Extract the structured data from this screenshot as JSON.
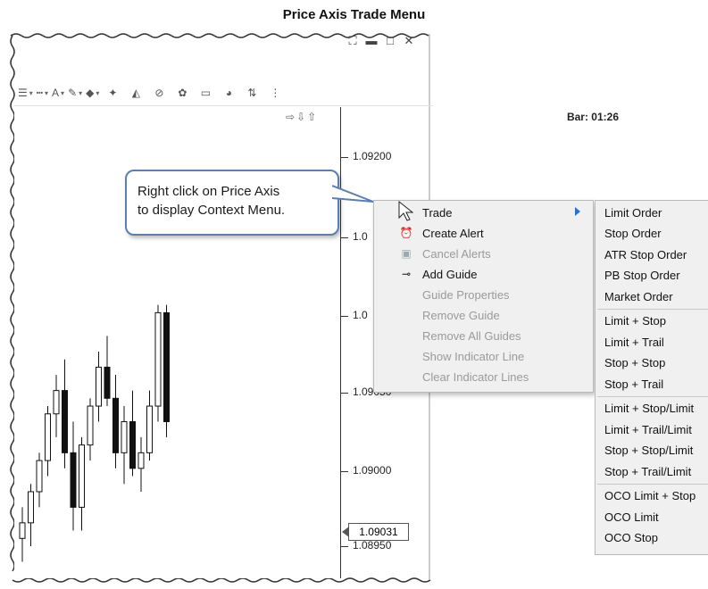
{
  "title": "Price Axis Trade Menu",
  "window_controls": {
    "maximize": "⛶",
    "minimize": "▬",
    "restore": "□",
    "close": "✕"
  },
  "toolbar": {
    "items": [
      {
        "icon": "lines-icon",
        "glyph": "☰",
        "dropdown": true
      },
      {
        "icon": "line-style-icon",
        "glyph": "┅",
        "dropdown": true
      },
      {
        "icon": "text-color-icon",
        "glyph": "A",
        "dropdown": true
      },
      {
        "icon": "pen-color-icon",
        "glyph": "✎",
        "dropdown": true
      },
      {
        "icon": "fill-color-icon",
        "glyph": "◆",
        "dropdown": true
      },
      {
        "icon": "chart-tool-icon",
        "glyph": "✦",
        "dropdown": false
      },
      {
        "icon": "callout-tool-icon",
        "glyph": "◭",
        "dropdown": false
      },
      {
        "icon": "hide-drawings-icon",
        "glyph": "⊘",
        "dropdown": false
      },
      {
        "icon": "indicator-icon",
        "glyph": "✿",
        "dropdown": false
      },
      {
        "icon": "panel-icon",
        "glyph": "▭",
        "dropdown": false
      },
      {
        "icon": "overlay-icon",
        "glyph": "◕",
        "dropdown": false
      },
      {
        "icon": "trade-arrows-icon",
        "glyph": "⇅",
        "dropdown": false
      },
      {
        "icon": "more-icon",
        "glyph": "⋮",
        "dropdown": false
      }
    ]
  },
  "chart": {
    "bar_info": "Bar: 01:26",
    "bar_arrows": "⇨⇩⇧",
    "price_labels": [
      "1.09200",
      "1.0",
      "1.0",
      "1.09050",
      "1.09000",
      "1.08950"
    ],
    "current_price": "1.09031",
    "candles": [
      {
        "o": 1.08955,
        "h": 1.08975,
        "l": 1.0894,
        "c": 1.08965,
        "bull": true
      },
      {
        "o": 1.08965,
        "h": 1.0899,
        "l": 1.0895,
        "c": 1.08985,
        "bull": true
      },
      {
        "o": 1.08985,
        "h": 1.0901,
        "l": 1.08975,
        "c": 1.09005,
        "bull": true
      },
      {
        "o": 1.09005,
        "h": 1.0904,
        "l": 1.08995,
        "c": 1.09035,
        "bull": true
      },
      {
        "o": 1.09035,
        "h": 1.0906,
        "l": 1.0902,
        "c": 1.0905,
        "bull": true
      },
      {
        "o": 1.0905,
        "h": 1.0907,
        "l": 1.09,
        "c": 1.0901,
        "bull": false
      },
      {
        "o": 1.0901,
        "h": 1.0903,
        "l": 1.0896,
        "c": 1.08975,
        "bull": false
      },
      {
        "o": 1.08975,
        "h": 1.0902,
        "l": 1.0896,
        "c": 1.09015,
        "bull": true
      },
      {
        "o": 1.09015,
        "h": 1.09045,
        "l": 1.09005,
        "c": 1.0904,
        "bull": true
      },
      {
        "o": 1.0904,
        "h": 1.09075,
        "l": 1.0903,
        "c": 1.09065,
        "bull": true
      },
      {
        "o": 1.09065,
        "h": 1.09085,
        "l": 1.0904,
        "c": 1.09045,
        "bull": false
      },
      {
        "o": 1.09045,
        "h": 1.0906,
        "l": 1.09,
        "c": 1.0901,
        "bull": false
      },
      {
        "o": 1.0901,
        "h": 1.0904,
        "l": 1.0899,
        "c": 1.0903,
        "bull": true
      },
      {
        "o": 1.0903,
        "h": 1.0905,
        "l": 1.08995,
        "c": 1.09,
        "bull": false
      },
      {
        "o": 1.09,
        "h": 1.0902,
        "l": 1.08985,
        "c": 1.0901,
        "bull": true
      },
      {
        "o": 1.0901,
        "h": 1.0905,
        "l": 1.09005,
        "c": 1.0904,
        "bull": true
      },
      {
        "o": 1.0904,
        "h": 1.09105,
        "l": 1.0903,
        "c": 1.091,
        "bull": true
      },
      {
        "o": 1.091,
        "h": 1.09105,
        "l": 1.0902,
        "c": 1.0903,
        "bull": false
      }
    ]
  },
  "callout": {
    "line1": "Right click on Price Axis",
    "line2": "to display Context Menu."
  },
  "context_menu": {
    "items": [
      {
        "label": "Trade",
        "icon": "cursor-icon",
        "glyph": "",
        "disabled": false,
        "submenu": true
      },
      {
        "label": "Create Alert",
        "icon": "alert-clock-icon",
        "glyph": "⏰",
        "disabled": false,
        "submenu": false
      },
      {
        "label": "Cancel Alerts",
        "icon": "cancel-alerts-icon",
        "glyph": "▣",
        "disabled": true,
        "submenu": false
      },
      {
        "label": "Add Guide",
        "icon": "guide-icon",
        "glyph": "⊸",
        "disabled": false,
        "submenu": false
      },
      {
        "label": "Guide Properties",
        "icon": "",
        "glyph": "",
        "disabled": true,
        "submenu": false
      },
      {
        "label": "Remove Guide",
        "icon": "",
        "glyph": "",
        "disabled": true,
        "submenu": false
      },
      {
        "label": "Remove All Guides",
        "icon": "",
        "glyph": "",
        "disabled": true,
        "submenu": false
      },
      {
        "label": "Show Indicator Line",
        "icon": "",
        "glyph": "",
        "disabled": true,
        "submenu": false
      },
      {
        "label": "Clear Indicator Lines",
        "icon": "",
        "glyph": "",
        "disabled": true,
        "submenu": false
      }
    ]
  },
  "trade_submenu": {
    "groups": [
      [
        "Limit Order",
        "Stop Order",
        "ATR Stop Order",
        "PB Stop Order",
        "Market Order"
      ],
      [
        "Limit + Stop",
        "Limit + Trail",
        "Stop + Stop",
        "Stop + Trail"
      ],
      [
        "Limit + Stop/Limit",
        "Limit + Trail/Limit",
        "Stop + Stop/Limit",
        "Stop + Trail/Limit"
      ],
      [
        "OCO Limit + Stop",
        "OCO Limit",
        "OCO Stop"
      ]
    ]
  }
}
